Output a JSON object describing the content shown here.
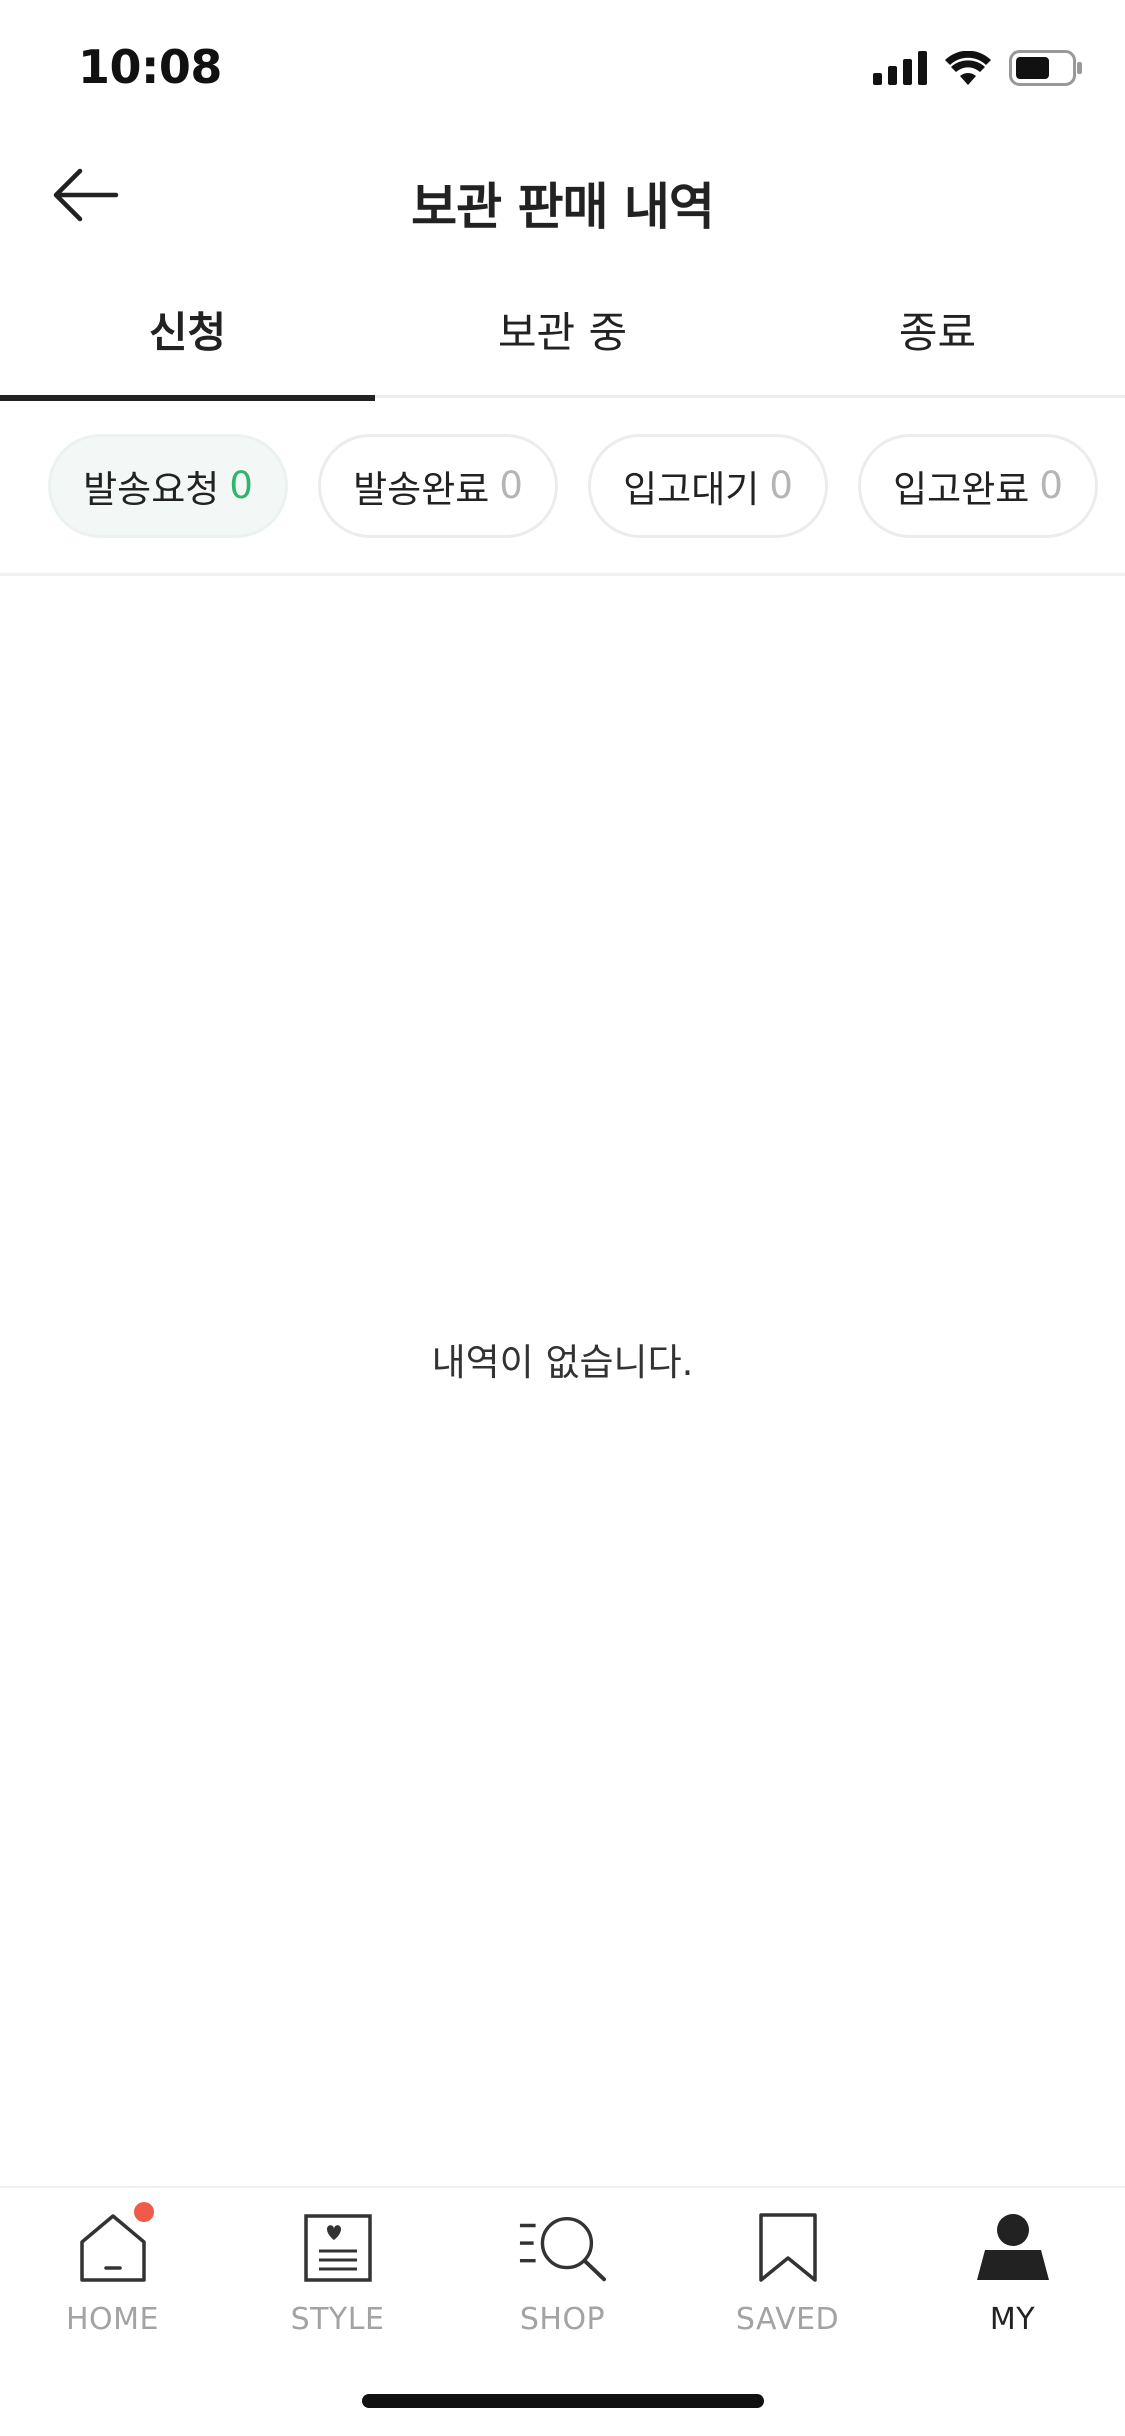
{
  "status_bar": {
    "time": "10:08"
  },
  "header": {
    "title": "보관 판매 내역",
    "back_icon": "arrow-left-icon"
  },
  "tabs": [
    {
      "label": "신청",
      "active": true
    },
    {
      "label": "보관 중",
      "active": false
    },
    {
      "label": "종료",
      "active": false
    }
  ],
  "chips": [
    {
      "label": "발송요청",
      "count": "0",
      "active": true
    },
    {
      "label": "발송완료",
      "count": "0",
      "active": false
    },
    {
      "label": "입고대기",
      "count": "0",
      "active": false
    },
    {
      "label": "입고완료",
      "count": "0",
      "active": false
    }
  ],
  "empty_state": {
    "message": "내역이 없습니다."
  },
  "bottom_nav": [
    {
      "label": "HOME",
      "icon": "home-icon",
      "has_badge": true,
      "active": false
    },
    {
      "label": "STYLE",
      "icon": "style-icon",
      "active": false
    },
    {
      "label": "SHOP",
      "icon": "shop-search-icon",
      "active": false
    },
    {
      "label": "SAVED",
      "icon": "bookmark-icon",
      "active": false
    },
    {
      "label": "MY",
      "icon": "profile-icon",
      "active": true
    }
  ],
  "colors": {
    "accent_green": "#31b46e",
    "badge_red": "#ef5a4a",
    "active_chip_bg": "#f3f8f6",
    "text_primary": "#222222",
    "text_muted": "#a3a3a3"
  }
}
